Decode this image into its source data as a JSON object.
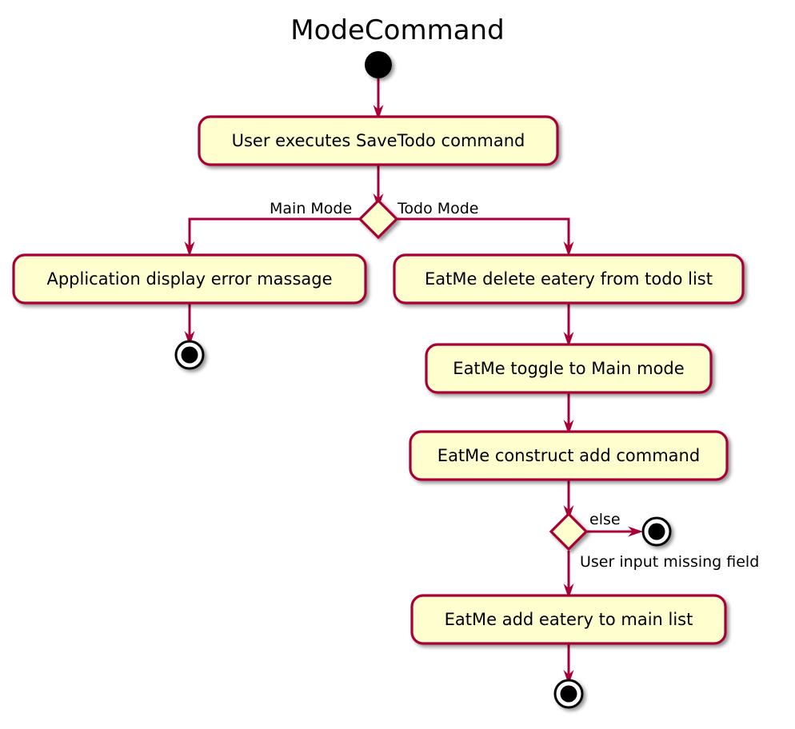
{
  "diagram": {
    "title": "ModeCommand",
    "type": "activity-diagram",
    "colors": {
      "node_fill": "#FEFECE",
      "node_border": "#A80036",
      "arrow": "#A80036",
      "text": "#000000",
      "terminal": "#000000",
      "background": "#FFFFFF"
    },
    "nodes": [
      {
        "id": "start",
        "kind": "start-node",
        "label": ""
      },
      {
        "id": "activity-save-todo",
        "kind": "activity",
        "label": "User executes SaveTodo command"
      },
      {
        "id": "decision-mode",
        "kind": "decision",
        "label": ""
      },
      {
        "id": "activity-error-message",
        "kind": "activity",
        "label": "Application display error massage"
      },
      {
        "id": "activity-delete-eatery",
        "kind": "activity",
        "label": "EatMe delete eatery from todo list"
      },
      {
        "id": "end-left",
        "kind": "end-node",
        "label": ""
      },
      {
        "id": "activity-toggle-main",
        "kind": "activity",
        "label": "EatMe toggle to Main mode"
      },
      {
        "id": "activity-construct-add",
        "kind": "activity",
        "label": "EatMe construct add command"
      },
      {
        "id": "decision-missing-field",
        "kind": "decision",
        "label": ""
      },
      {
        "id": "end-else",
        "kind": "end-node",
        "label": ""
      },
      {
        "id": "activity-add-eatery",
        "kind": "activity",
        "label": "EatMe add eatery to main list"
      },
      {
        "id": "end-bottom",
        "kind": "end-node",
        "label": ""
      }
    ],
    "edge_labels": {
      "main_mode": "Main Mode",
      "todo_mode": "Todo Mode",
      "else": "else",
      "missing_field": "User input missing field"
    }
  }
}
